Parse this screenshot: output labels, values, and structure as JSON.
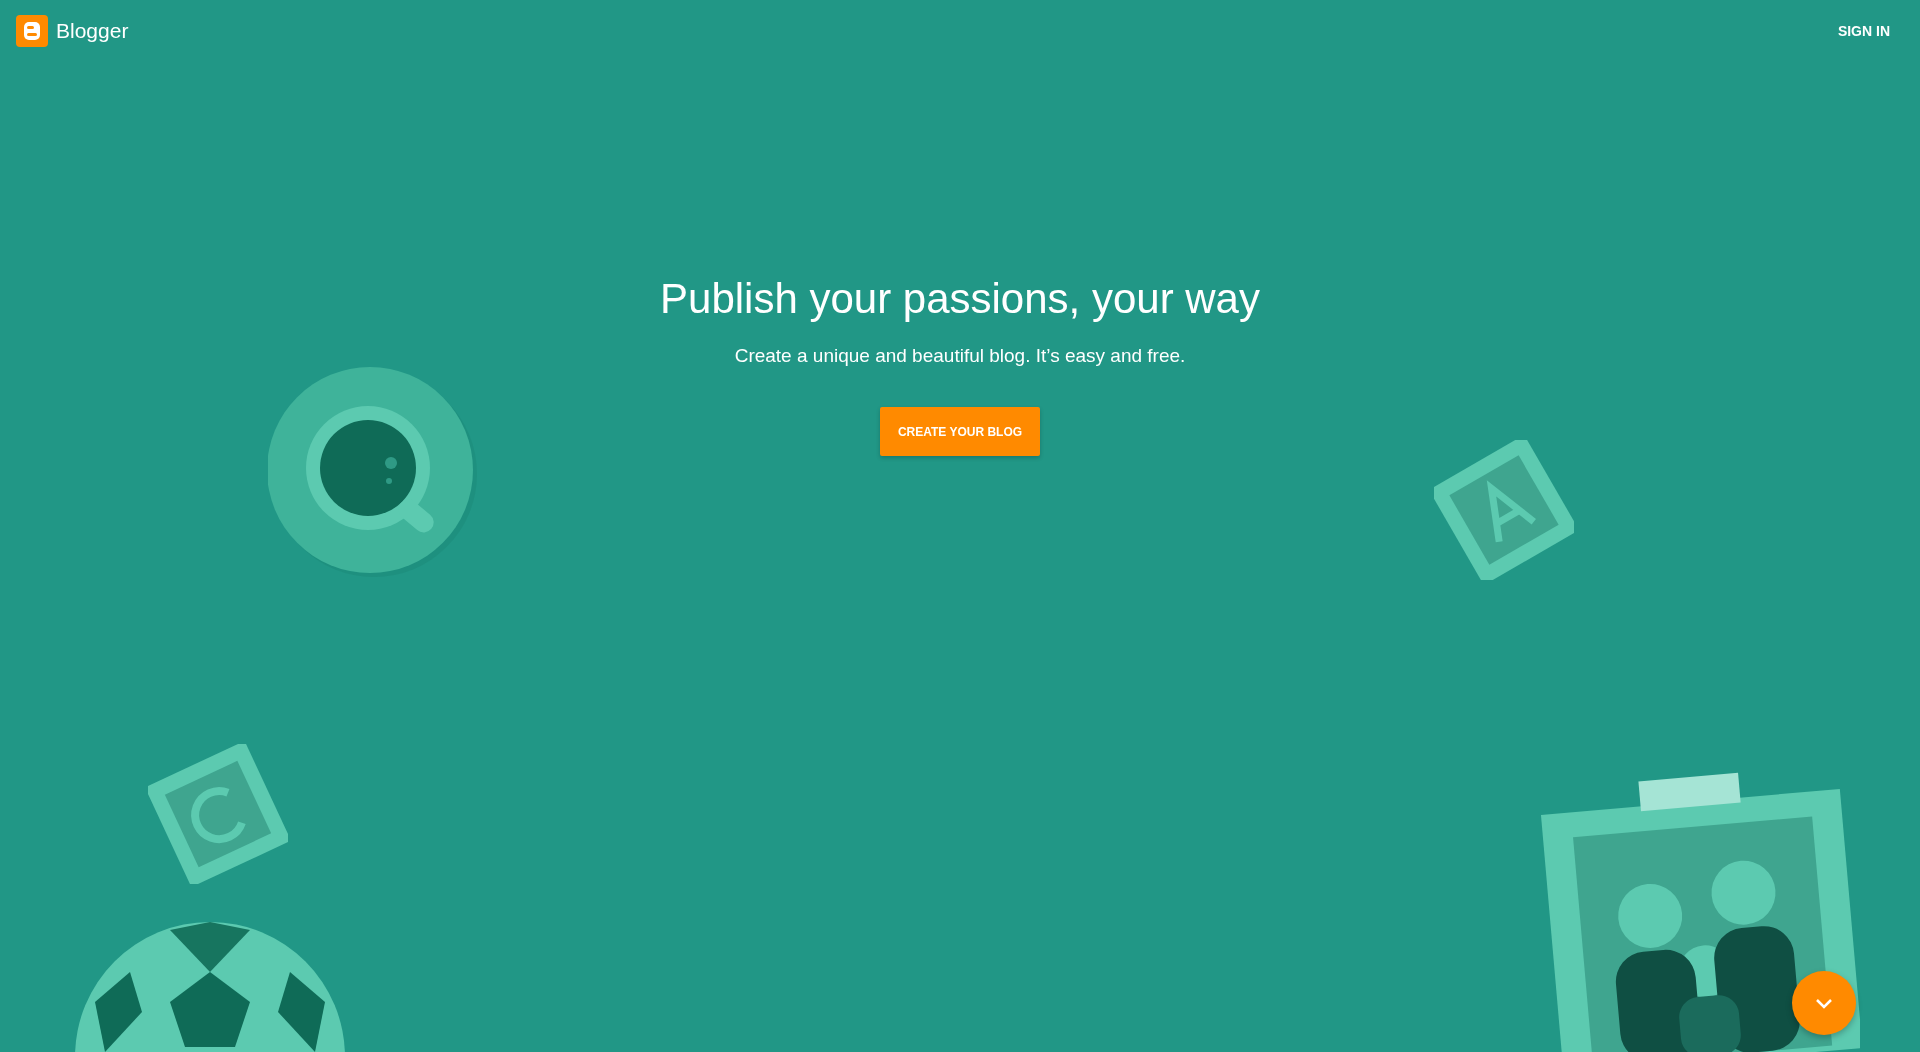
{
  "header": {
    "brand": "Blogger",
    "sign_in": "SIGN IN"
  },
  "hero": {
    "title": "Publish your passions, your way",
    "subtitle": "Create a unique and beautiful blog. It’s easy and free.",
    "cta": "CREATE YOUR BLOG"
  }
}
